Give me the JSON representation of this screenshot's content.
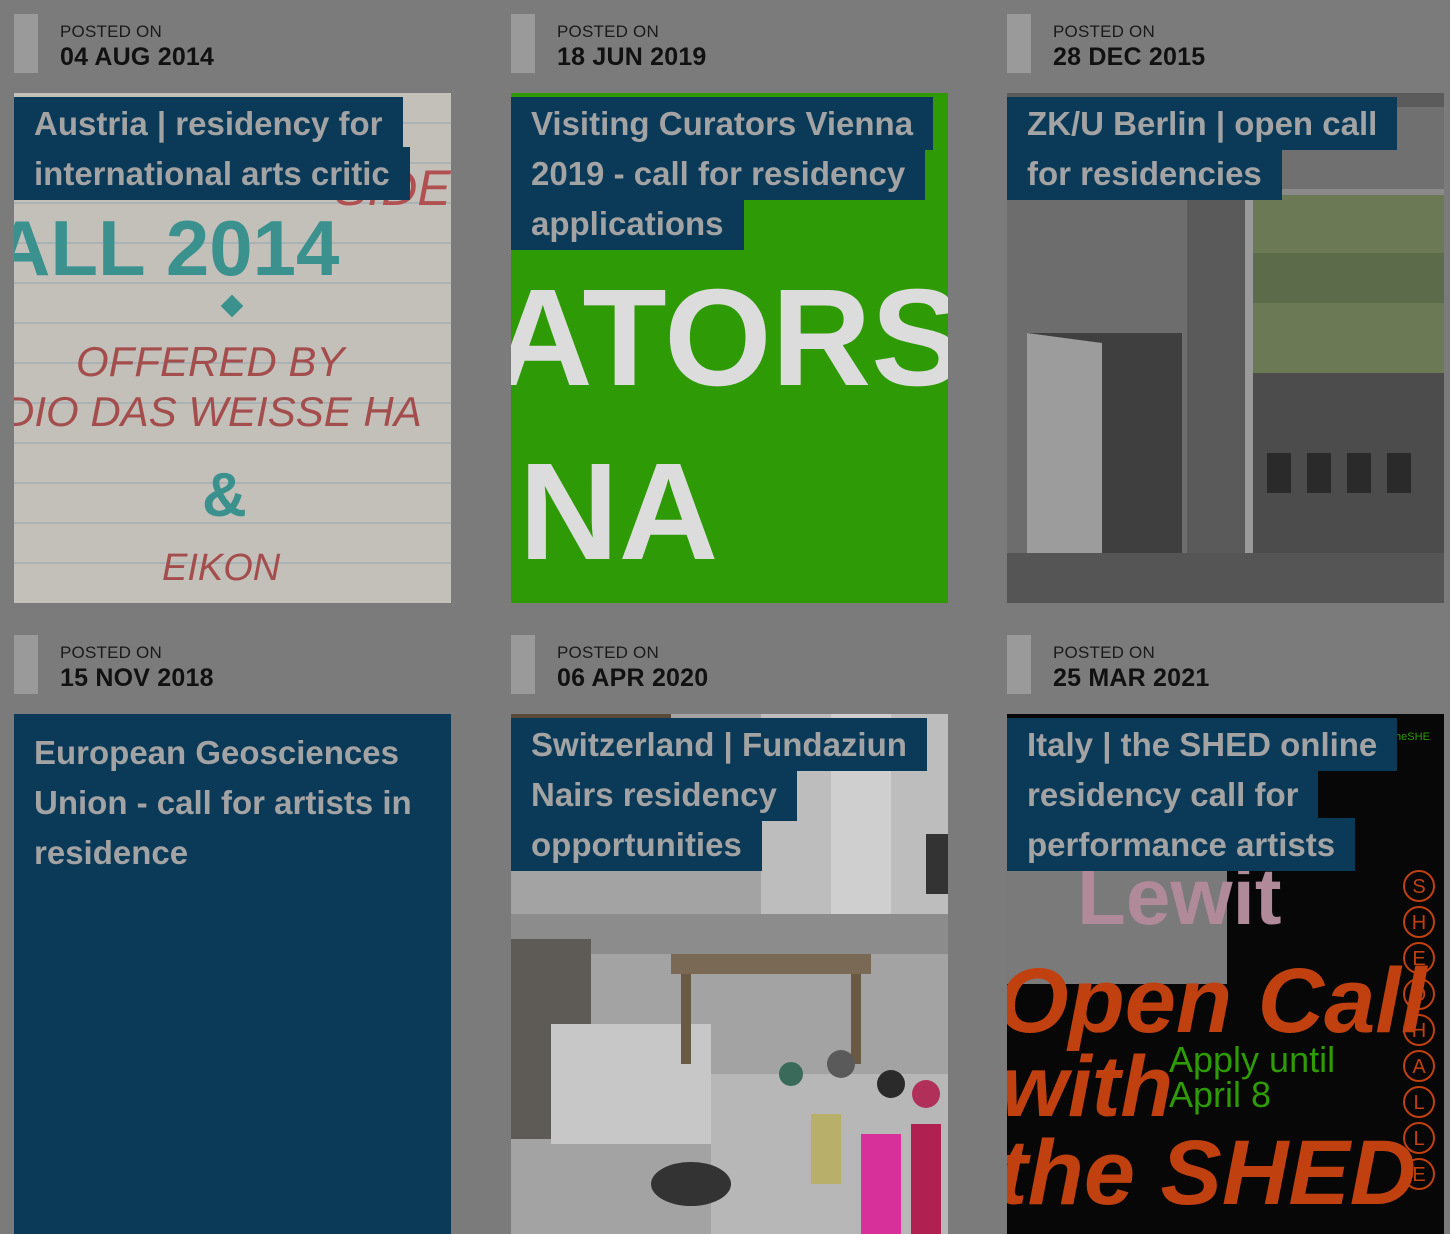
{
  "posted_label": "POSTED ON",
  "posts": [
    {
      "date": "04 AUG 2014",
      "title": "Austria | residency for international arts critic",
      "image_text": {
        "line1": "SIDE",
        "line2": "ALL 2014",
        "line3": "OFFERED BY",
        "line4": "DIO DAS WEISSE HA",
        "line5": "&",
        "line6": "EIKON"
      }
    },
    {
      "date": "18 JUN 2019",
      "title": "Visiting Curators Vienna 2019 - call for residency applications",
      "image_text": {
        "line1": "ATORS",
        "line2": "NA"
      }
    },
    {
      "date": "28 DEC 2015",
      "title": "ZK/U Berlin | open call for residencies"
    },
    {
      "date": "15 NOV 2018",
      "title": "European Geosciences Union - call for artists in residence"
    },
    {
      "date": "06 APR 2020",
      "title": "Switzerland | Fundaziun Nairs residency opportunities"
    },
    {
      "date": "25 MAR 2021",
      "title": "Italy | the SHED online residency call for performance artists",
      "image_text": {
        "tag": "theSHE",
        "line1": "Open Call",
        "line2": "with",
        "line3": "Apply until",
        "line4": "April 8",
        "line5": "the SHED",
        "line6": "Lewit",
        "letters": [
          "S",
          "H",
          "E",
          "D",
          "H",
          "A",
          "L",
          "L",
          "E"
        ]
      }
    }
  ],
  "colors": {
    "title_bg": "#0b3a59",
    "title_text": "#a3a3a3",
    "page_bg": "#7b7b7b",
    "green": "#2e9a05",
    "orange": "#c1400f"
  }
}
